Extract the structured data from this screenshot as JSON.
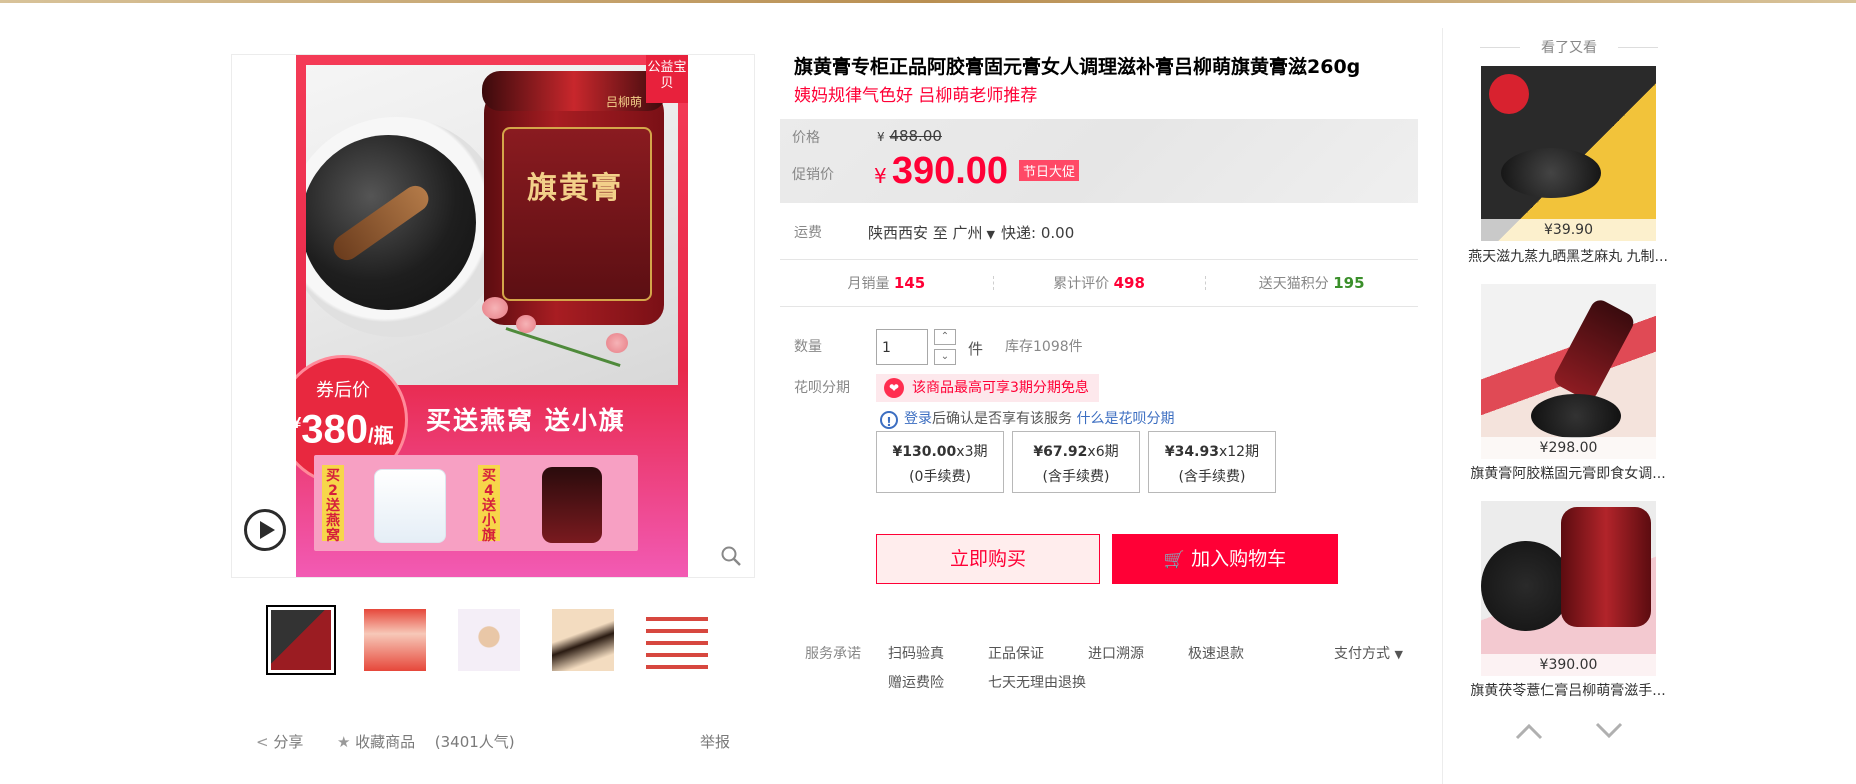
{
  "product": {
    "title": "旗黄膏专柜正品阿胶膏固元膏女人调理滋补膏吕柳萌旗黄膏滋260g",
    "subtitle": "姨妈规律气色好 吕柳萌老师推荐",
    "original_price_label": "价格",
    "original_price_currency": "¥",
    "original_price": "488.00",
    "promo_price_label": "促销价",
    "promo_currency": "¥",
    "promo_price": "390.00",
    "promo_tag": "节日大促"
  },
  "gallery": {
    "corner_badge": "公益宝贝",
    "brand_small": "吕柳萌",
    "jar_title": "旗黄膏",
    "coupon_label": "券后价",
    "coupon_currency": "¥",
    "coupon_price": "380",
    "coupon_unit": "/瓶",
    "promo_text": "买送燕窝  送小旗",
    "gift1_tag": "买2送燕窝",
    "gift2_tag": "买4送小旗",
    "thumbnails": [
      "thumb-1",
      "thumb-2",
      "thumb-3",
      "thumb-4",
      "thumb-5"
    ]
  },
  "shipping": {
    "label": "运费",
    "text": "陕西西安  至 广州",
    "express": "快递: 0.00"
  },
  "stats": [
    {
      "label": "月销量",
      "value": "145",
      "color": "#ff0036"
    },
    {
      "label": "累计评价",
      "value": "498",
      "color": "#ff0036"
    },
    {
      "label": "送天猫积分",
      "value": "195",
      "color": "#3a8f2a"
    }
  ],
  "quantity": {
    "label": "数量",
    "value": "1",
    "unit": "件",
    "stock": "库存1098件"
  },
  "huabei": {
    "label": "花呗分期",
    "note": "该商品最高可享3期分期免息",
    "login": "登录",
    "login_hint": "后确认是否享有该服务 ",
    "what_is": "什么是花呗分期",
    "plans": [
      {
        "amount": "¥130.00",
        "periods": "x3期",
        "fee": "(0手续费)"
      },
      {
        "amount": "¥67.92",
        "periods": "x6期",
        "fee": "(含手续费)"
      },
      {
        "amount": "¥34.93",
        "periods": "x12期",
        "fee": "(含手续费)"
      }
    ]
  },
  "actions": {
    "buy_now": "立即购买",
    "add_to_cart": "加入购物车"
  },
  "service": {
    "label": "服务承诺",
    "items": [
      "扫码验真",
      "正品保证",
      "进口溯源",
      "极速退款",
      "赠运费险",
      "七天无理由退换"
    ],
    "payment": "支付方式"
  },
  "social": {
    "share": "分享",
    "favorite": "收藏商品",
    "popularity": "(3401人气)",
    "report": "举报"
  },
  "sidebar": {
    "heading": "看了又看",
    "items": [
      {
        "price": "¥39.90",
        "name": "燕天滋九蒸九晒黑芝麻丸 九制..."
      },
      {
        "price": "¥298.00",
        "name": "旗黄膏阿胶糕固元膏即食女调..."
      },
      {
        "price": "¥390.00",
        "name": "旗黄茯苓薏仁膏吕柳萌膏滋手..."
      }
    ]
  },
  "colors": {
    "accent": "#ff0036",
    "link": "#3c6ec1"
  }
}
